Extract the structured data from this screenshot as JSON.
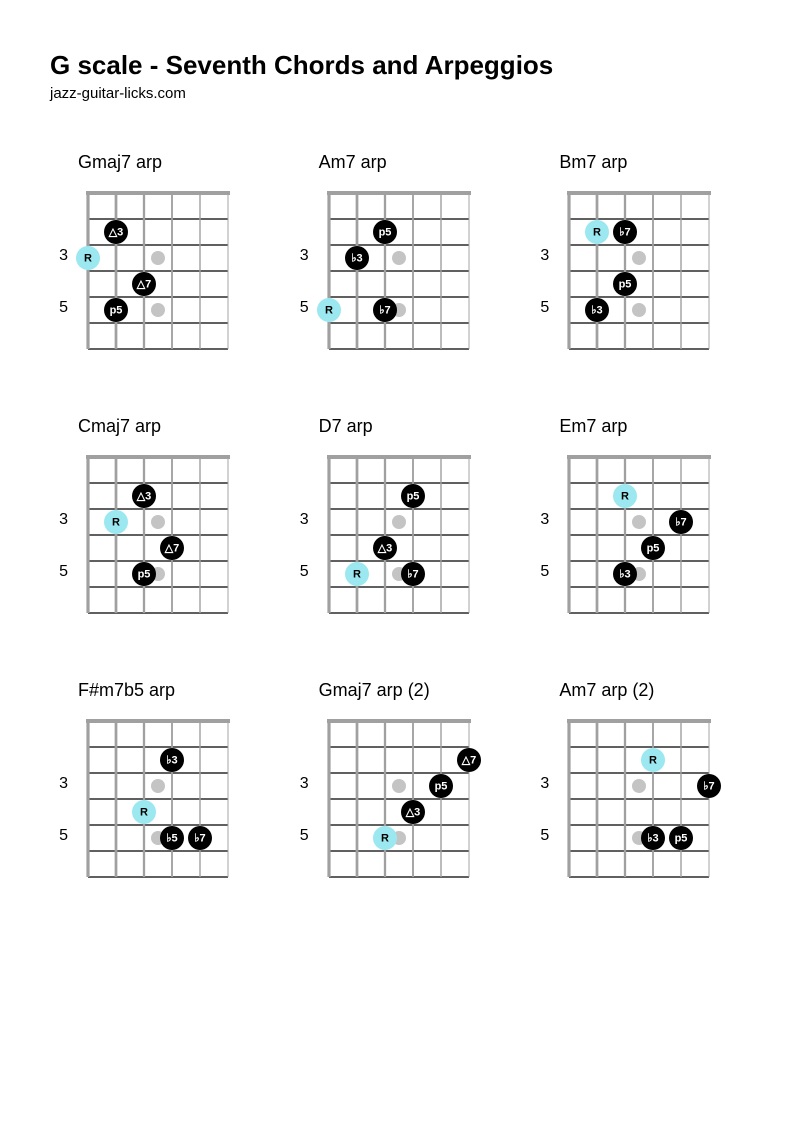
{
  "title": "G scale - Seventh Chords and Arpeggios",
  "subtitle": "jazz-guitar-licks.com",
  "colors": {
    "root": "#9CE8F0",
    "note": "#000000",
    "marker": "#C4C4C4",
    "fret": "#000000",
    "string": "#A0A0A0",
    "nut": "#A0A0A0"
  },
  "layout": {
    "numStrings": 6,
    "numFrets": 6,
    "stringSpacing": 28,
    "fretSpacing": 26,
    "dotRadius": 12,
    "markerRadius": 7
  },
  "fretMarkers": [
    {
      "fret": 3,
      "afterString": 4
    },
    {
      "fret": 5,
      "afterString": 4
    }
  ],
  "fretLabelPositions": [
    "",
    "",
    "3",
    "",
    "5",
    ""
  ],
  "diagrams": [
    {
      "name": "Gmaj7 arp",
      "notes": [
        {
          "string": 6,
          "fret": 3,
          "label": "R",
          "type": "root"
        },
        {
          "string": 5,
          "fret": 2,
          "label": "△3",
          "type": "note"
        },
        {
          "string": 4,
          "fret": 4,
          "label": "△7",
          "type": "note"
        },
        {
          "string": 5,
          "fret": 5,
          "label": "p5",
          "type": "note"
        }
      ]
    },
    {
      "name": "Am7 arp",
      "notes": [
        {
          "string": 6,
          "fret": 5,
          "label": "R",
          "type": "root"
        },
        {
          "string": 5,
          "fret": 3,
          "label": "♭3",
          "type": "note"
        },
        {
          "string": 4,
          "fret": 2,
          "label": "p5",
          "type": "note"
        },
        {
          "string": 4,
          "fret": 5,
          "label": "♭7",
          "type": "note"
        }
      ]
    },
    {
      "name": "Bm7 arp",
      "notes": [
        {
          "string": 5,
          "fret": 2,
          "label": "R",
          "type": "root"
        },
        {
          "string": 4,
          "fret": 2,
          "label": "♭7",
          "type": "note"
        },
        {
          "string": 4,
          "fret": 4,
          "label": "p5",
          "type": "note"
        },
        {
          "string": 5,
          "fret": 5,
          "label": "♭3",
          "type": "note"
        }
      ]
    },
    {
      "name": "Cmaj7 arp",
      "notes": [
        {
          "string": 5,
          "fret": 3,
          "label": "R",
          "type": "root"
        },
        {
          "string": 4,
          "fret": 2,
          "label": "△3",
          "type": "note"
        },
        {
          "string": 3,
          "fret": 4,
          "label": "△7",
          "type": "note"
        },
        {
          "string": 4,
          "fret": 5,
          "label": "p5",
          "type": "note"
        }
      ]
    },
    {
      "name": "D7 arp",
      "notes": [
        {
          "string": 5,
          "fret": 5,
          "label": "R",
          "type": "root"
        },
        {
          "string": 4,
          "fret": 4,
          "label": "△3",
          "type": "note"
        },
        {
          "string": 3,
          "fret": 2,
          "label": "p5",
          "type": "note"
        },
        {
          "string": 3,
          "fret": 5,
          "label": "♭7",
          "type": "note"
        }
      ]
    },
    {
      "name": "Em7 arp",
      "notes": [
        {
          "string": 4,
          "fret": 2,
          "label": "R",
          "type": "root"
        },
        {
          "string": 4,
          "fret": 5,
          "label": "♭3",
          "type": "note"
        },
        {
          "string": 3,
          "fret": 4,
          "label": "p5",
          "type": "note"
        },
        {
          "string": 2,
          "fret": 3,
          "label": "♭7",
          "type": "note"
        }
      ]
    },
    {
      "name": "F#m7b5 arp",
      "notes": [
        {
          "string": 4,
          "fret": 4,
          "label": "R",
          "type": "root"
        },
        {
          "string": 3,
          "fret": 2,
          "label": "♭3",
          "type": "note"
        },
        {
          "string": 3,
          "fret": 5,
          "label": "♭5",
          "type": "note"
        },
        {
          "string": 2,
          "fret": 5,
          "label": "♭7",
          "type": "note"
        }
      ]
    },
    {
      "name": "Gmaj7 arp (2)",
      "notes": [
        {
          "string": 4,
          "fret": 5,
          "label": "R",
          "type": "root"
        },
        {
          "string": 3,
          "fret": 4,
          "label": "△3",
          "type": "note"
        },
        {
          "string": 2,
          "fret": 3,
          "label": "p5",
          "type": "note"
        },
        {
          "string": 1,
          "fret": 2,
          "label": "△7",
          "type": "note"
        }
      ]
    },
    {
      "name": "Am7 arp (2)",
      "notes": [
        {
          "string": 3,
          "fret": 2,
          "label": "R",
          "type": "root"
        },
        {
          "string": 3,
          "fret": 5,
          "label": "♭3",
          "type": "note"
        },
        {
          "string": 2,
          "fret": 5,
          "label": "p5",
          "type": "note"
        },
        {
          "string": 1,
          "fret": 3,
          "label": "♭7",
          "type": "note"
        }
      ]
    }
  ]
}
